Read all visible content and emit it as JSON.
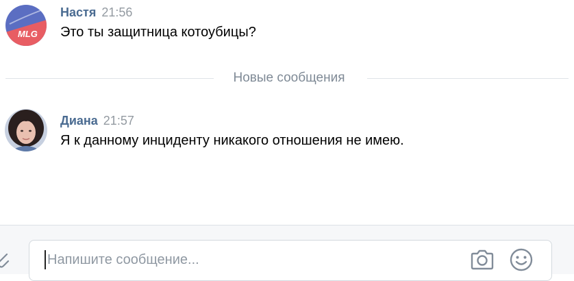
{
  "messages": [
    {
      "author": "Настя",
      "time": "21:56",
      "text": "Это ты защитница котоубицы?",
      "avatar_text": "MLG",
      "avatar_colors": {
        "top": "#5b6ec2",
        "bottom": "#e85d63",
        "text": "#ffffff"
      }
    },
    {
      "author": "Диана",
      "time": "21:57",
      "text": "Я к данному инциденту никакого отношения не имею.",
      "avatar_colors": {
        "bg": "#c7d0e0",
        "hair": "#2a1f1e",
        "skin": "#e9c0b0"
      }
    }
  ],
  "divider": {
    "label": "Новые сообщения"
  },
  "composer": {
    "placeholder": "Напишите сообщение...",
    "value": "",
    "icons": [
      "attach-icon",
      "camera-icon",
      "smile-icon"
    ]
  },
  "colors": {
    "author": "#4a6b91",
    "time": "#939aa1",
    "divider_text": "#7f8a96",
    "icon": "#818c99"
  }
}
